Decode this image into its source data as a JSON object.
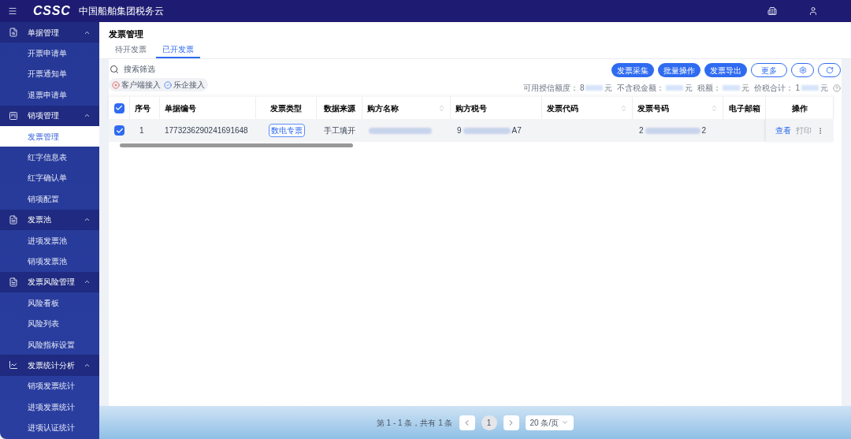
{
  "header": {
    "title": "中国船舶集团税务云",
    "logo": "CSSC"
  },
  "sidebar": [
    {
      "label": "单据管理",
      "expanded": true,
      "children": [
        {
          "label": "开票申请单",
          "selected": false
        },
        {
          "label": "开票通知单",
          "selected": false
        },
        {
          "label": "退票申请单",
          "selected": false
        }
      ]
    },
    {
      "label": "销项管理",
      "expanded": true,
      "children": [
        {
          "label": "发票管理",
          "selected": true
        },
        {
          "label": "红字信息表",
          "selected": false
        },
        {
          "label": "红字确认单",
          "selected": false
        },
        {
          "label": "销项配置",
          "selected": false
        }
      ]
    },
    {
      "label": "发票池",
      "expanded": true,
      "children": [
        {
          "label": "进项发票池",
          "selected": false
        },
        {
          "label": "销项发票池",
          "selected": false
        }
      ]
    },
    {
      "label": "发票风险管理",
      "expanded": true,
      "children": [
        {
          "label": "风险看板",
          "selected": false
        },
        {
          "label": "风险列表",
          "selected": false
        },
        {
          "label": "风险指标设置",
          "selected": false
        }
      ]
    },
    {
      "label": "发票统计分析",
      "expanded": true,
      "children": [
        {
          "label": "销项发票统计",
          "selected": false
        },
        {
          "label": "进项发票统计",
          "selected": false
        },
        {
          "label": "进项认证统计",
          "selected": false
        }
      ]
    }
  ],
  "page_title": "发票管理",
  "tabs": [
    {
      "label": "待开发票",
      "selected": false
    },
    {
      "label": "已开发票",
      "selected": true
    }
  ],
  "search": {
    "placeholder": "搜索筛选"
  },
  "chips": [
    {
      "label": "客户端接入",
      "kind": "error"
    },
    {
      "label": "乐企接入",
      "kind": "ok"
    }
  ],
  "buttons": [
    {
      "label": "发票采集",
      "kind": "primary"
    },
    {
      "label": "批量操作",
      "kind": "primary"
    },
    {
      "label": "发票导出",
      "kind": "primary"
    },
    {
      "label": "更多",
      "kind": "outline"
    },
    {
      "kind": "settings"
    },
    {
      "kind": "refresh"
    }
  ],
  "summary": [
    {
      "label": "可用授信额度：",
      "value": "8",
      "unit": "元"
    },
    {
      "label": "不含税金额：",
      "unit": "元"
    },
    {
      "label": "税额：",
      "unit": "元"
    },
    {
      "label": "价税合计：",
      "value": "1",
      "unit": "元"
    }
  ],
  "table": {
    "all_checked": true,
    "columns": [
      {
        "label": "序号",
        "sortable": false
      },
      {
        "label": "单据编号",
        "sortable": false
      },
      {
        "label": "发票类型",
        "sortable": false
      },
      {
        "label": "数据来源",
        "sortable": false
      },
      {
        "label": "购方名称",
        "sortable": true
      },
      {
        "label": "购方税号",
        "sortable": false
      },
      {
        "label": "发票代码",
        "sortable": true
      },
      {
        "label": "发票号码",
        "sortable": true
      },
      {
        "label": "电子邮箱",
        "sortable": false
      },
      {
        "label": "操作",
        "sortable": false
      }
    ],
    "rows": [
      {
        "checked": true,
        "index": "1",
        "doc_no": "1773236290241691648",
        "type": "数电专票",
        "source": "手工填开",
        "buyer_tax_prefix": "9",
        "buyer_tax_suffix": "A7",
        "invoice_no_prefix": "2",
        "invoice_no_suffix": "2",
        "actions": [
          {
            "label": "查看",
            "disabled": false
          },
          {
            "label": "打印",
            "disabled": true
          }
        ]
      }
    ]
  },
  "pagination": {
    "summary": "第 1 - 1 条，共有 1 条",
    "page": "1",
    "page_size": "20 条/页"
  }
}
